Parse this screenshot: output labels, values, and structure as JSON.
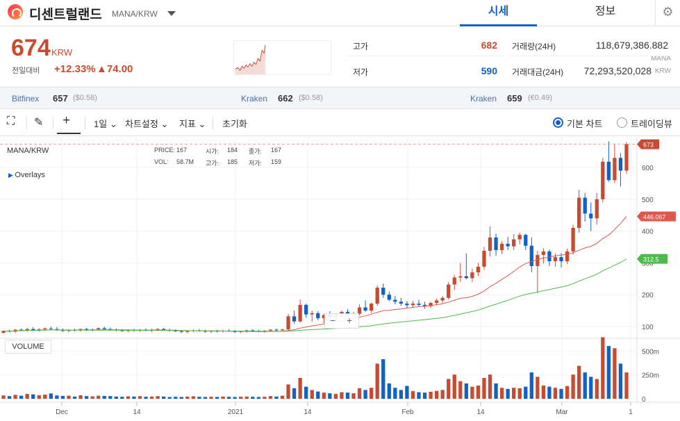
{
  "header": {
    "coin_name": "디센트럴랜드",
    "pair": "MANA/KRW",
    "tab_price": "시세",
    "tab_info": "정보"
  },
  "summary": {
    "price": "674",
    "unit": "KRW",
    "change_label": "전일대비",
    "change_rate": "+12.33%",
    "change_value": "▲74.00",
    "high_label": "고가",
    "high_value": "682",
    "low_label": "저가",
    "low_value": "590",
    "volume_label": "거래량(24H)",
    "volume_value": "118,679,386.882",
    "volume_unit": "MANA",
    "amount_label": "거래대금(24H)",
    "amount_value": "72,293,520,028",
    "amount_unit": "KRW"
  },
  "exchanges": [
    {
      "name": "Bitfinex",
      "price": "657",
      "sub": "($0.58)"
    },
    {
      "name": "Kraken",
      "price": "662",
      "sub": "($0.58)"
    },
    {
      "name": "Kraken",
      "price": "659",
      "sub": "(€0.49)"
    }
  ],
  "toolbar": {
    "period": "1일",
    "chart_settings": "차트설정",
    "indicators": "지표",
    "reset": "초기화",
    "basic_chart": "기본 차트",
    "tradingview": "트레이딩뷰"
  },
  "chart": {
    "pair": "MANA/KRW",
    "overlays": "Overlays",
    "ohlc": {
      "price_label": "PRICE:",
      "price": "167",
      "open_label": "시가:",
      "open": "184",
      "close_label": "종가:",
      "close": "167",
      "vol_label": "VOL:",
      "vol": "58.7M",
      "high_label": "고가:",
      "high": "185",
      "low_label": "저가:",
      "low": "159"
    },
    "volume_label": "VOLUME",
    "last_price_tag": "673",
    "ma1_tag": "446.067",
    "ma2_tag": "312.5",
    "colors": {
      "up": "#c84a31",
      "down": "#1261c4",
      "ma1": "#e0574f",
      "ma2": "#4cbb4c"
    }
  },
  "chart_data": {
    "type": "candlestick",
    "price_axis_ticks": [
      100,
      200,
      300,
      400,
      500,
      600
    ],
    "volume_axis_ticks": [
      "0",
      "250m",
      "500m"
    ],
    "x_tick_labels": [
      "Dec",
      "14",
      "2021",
      "14",
      "Feb",
      "14",
      "Mar",
      "1"
    ],
    "candles": [
      [
        80,
        88,
        78,
        86,
        15
      ],
      [
        86,
        90,
        82,
        84,
        12
      ],
      [
        84,
        92,
        80,
        90,
        18
      ],
      [
        90,
        94,
        86,
        88,
        14
      ],
      [
        88,
        96,
        84,
        92,
        22
      ],
      [
        92,
        98,
        86,
        89,
        20
      ],
      [
        89,
        95,
        84,
        91,
        16
      ],
      [
        91,
        97,
        87,
        94,
        19
      ],
      [
        94,
        100,
        90,
        92,
        24
      ],
      [
        92,
        98,
        86,
        90,
        15
      ],
      [
        90,
        94,
        84,
        86,
        13
      ],
      [
        86,
        92,
        82,
        89,
        14
      ],
      [
        89,
        93,
        85,
        88,
        10
      ],
      [
        88,
        94,
        84,
        92,
        16
      ],
      [
        92,
        96,
        86,
        89,
        12
      ],
      [
        89,
        94,
        85,
        91,
        11
      ],
      [
        91,
        97,
        87,
        95,
        14
      ],
      [
        95,
        99,
        89,
        92,
        13
      ],
      [
        92,
        97,
        87,
        90,
        12
      ],
      [
        90,
        94,
        85,
        88,
        10
      ],
      [
        88,
        92,
        83,
        86,
        9
      ],
      [
        86,
        91,
        82,
        89,
        11
      ],
      [
        89,
        93,
        84,
        87,
        10
      ],
      [
        87,
        92,
        83,
        90,
        12
      ],
      [
        90,
        94,
        85,
        88,
        9
      ],
      [
        88,
        93,
        83,
        90,
        10
      ],
      [
        90,
        95,
        86,
        92,
        12
      ],
      [
        92,
        96,
        86,
        89,
        10
      ],
      [
        89,
        93,
        84,
        87,
        8
      ],
      [
        87,
        91,
        83,
        85,
        9
      ],
      [
        85,
        89,
        80,
        83,
        8
      ],
      [
        83,
        88,
        79,
        86,
        10
      ],
      [
        86,
        91,
        82,
        88,
        11
      ],
      [
        88,
        92,
        84,
        86,
        9
      ],
      [
        86,
        90,
        81,
        84,
        8
      ],
      [
        84,
        88,
        80,
        86,
        9
      ],
      [
        86,
        90,
        82,
        85,
        8
      ],
      [
        85,
        89,
        81,
        87,
        10
      ],
      [
        87,
        92,
        83,
        85,
        9
      ],
      [
        85,
        89,
        80,
        83,
        8
      ],
      [
        83,
        87,
        79,
        85,
        9
      ],
      [
        85,
        90,
        81,
        88,
        10
      ],
      [
        88,
        92,
        83,
        86,
        9
      ],
      [
        86,
        90,
        82,
        84,
        8
      ],
      [
        84,
        89,
        80,
        87,
        9
      ],
      [
        87,
        92,
        83,
        90,
        12
      ],
      [
        90,
        94,
        85,
        88,
        10
      ],
      [
        88,
        93,
        84,
        91,
        14
      ],
      [
        91,
        140,
        88,
        132,
        65
      ],
      [
        132,
        150,
        108,
        116,
        48
      ],
      [
        116,
        185,
        112,
        168,
        95
      ],
      [
        168,
        172,
        128,
        138,
        55
      ],
      [
        138,
        150,
        115,
        142,
        40
      ],
      [
        142,
        148,
        120,
        126,
        33
      ],
      [
        126,
        140,
        110,
        136,
        28
      ],
      [
        136,
        148,
        122,
        131,
        25
      ],
      [
        131,
        142,
        118,
        140,
        22
      ],
      [
        140,
        150,
        128,
        146,
        30
      ],
      [
        146,
        155,
        130,
        136,
        28
      ],
      [
        136,
        146,
        124,
        140,
        25
      ],
      [
        140,
        170,
        135,
        160,
        48
      ],
      [
        160,
        182,
        146,
        150,
        40
      ],
      [
        150,
        175,
        142,
        172,
        50
      ],
      [
        172,
        230,
        165,
        222,
        160
      ],
      [
        222,
        235,
        190,
        200,
        180
      ],
      [
        200,
        210,
        180,
        184,
        70
      ],
      [
        184,
        196,
        170,
        178,
        50
      ],
      [
        178,
        190,
        165,
        172,
        40
      ],
      [
        172,
        180,
        158,
        167,
        58.7
      ],
      [
        167,
        180,
        158,
        172,
        35
      ],
      [
        172,
        184,
        162,
        168,
        30
      ],
      [
        168,
        178,
        156,
        164,
        28
      ],
      [
        164,
        178,
        158,
        174,
        32
      ],
      [
        174,
        188,
        168,
        182,
        36
      ],
      [
        182,
        196,
        174,
        190,
        40
      ],
      [
        190,
        240,
        185,
        232,
        90
      ],
      [
        232,
        262,
        215,
        254,
        110
      ],
      [
        254,
        300,
        240,
        258,
        80
      ],
      [
        258,
        330,
        248,
        252,
        70
      ],
      [
        252,
        282,
        240,
        270,
        55
      ],
      [
        270,
        300,
        258,
        288,
        60
      ],
      [
        288,
        350,
        278,
        338,
        95
      ],
      [
        338,
        415,
        320,
        380,
        110
      ],
      [
        380,
        392,
        322,
        340,
        70
      ],
      [
        340,
        368,
        328,
        360,
        50
      ],
      [
        360,
        382,
        340,
        352,
        45
      ],
      [
        352,
        390,
        340,
        374,
        50
      ],
      [
        374,
        395,
        358,
        388,
        48
      ],
      [
        388,
        392,
        340,
        354,
        55
      ],
      [
        354,
        380,
        270,
        290,
        120
      ],
      [
        290,
        338,
        205,
        325,
        100
      ],
      [
        325,
        346,
        298,
        336,
        60
      ],
      [
        336,
        342,
        290,
        305,
        55
      ],
      [
        305,
        330,
        288,
        318,
        50
      ],
      [
        318,
        330,
        286,
        305,
        45
      ],
      [
        305,
        345,
        296,
        336,
        58
      ],
      [
        336,
        420,
        326,
        410,
        110
      ],
      [
        410,
        530,
        395,
        505,
        150
      ],
      [
        505,
        520,
        430,
        455,
        120
      ],
      [
        455,
        490,
        400,
        440,
        100
      ],
      [
        440,
        520,
        420,
        500,
        90
      ],
      [
        500,
        630,
        490,
        618,
        280
      ],
      [
        618,
        682,
        555,
        560,
        240
      ],
      [
        560,
        675,
        550,
        630,
        230
      ],
      [
        630,
        645,
        540,
        590,
        160
      ],
      [
        590,
        680,
        580,
        673,
        120
      ]
    ],
    "ma1": [
      446.067
    ],
    "ma2": [
      312.5
    ]
  }
}
